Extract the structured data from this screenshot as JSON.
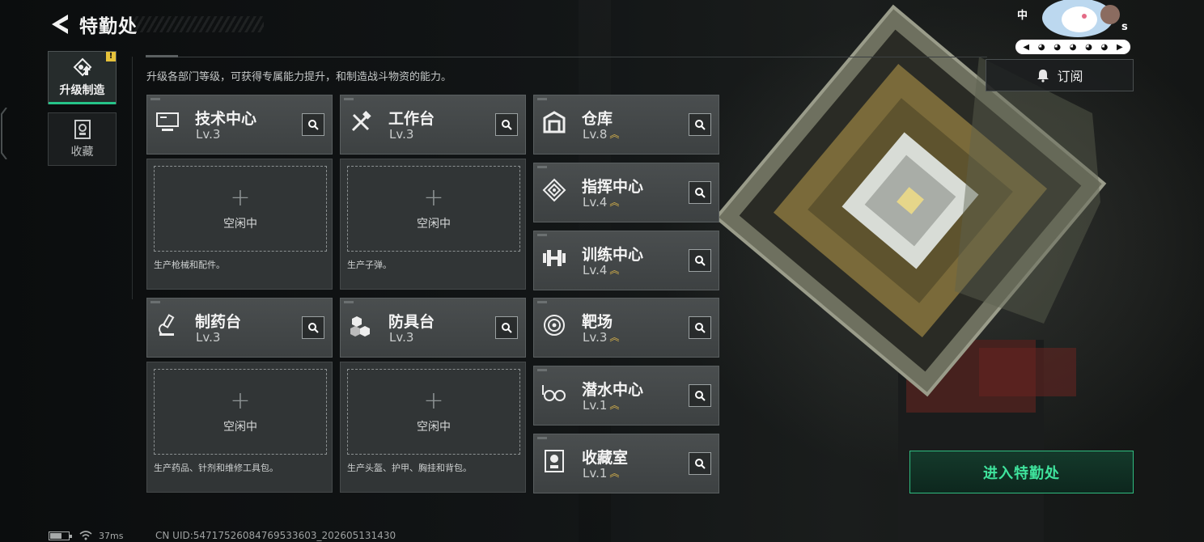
{
  "header": {
    "title": "特勤处"
  },
  "side_tabs": [
    {
      "label": "升级制造",
      "icon": "upgrade-manufacture-icon",
      "badge": "!",
      "active": true
    },
    {
      "label": "收藏",
      "icon": "collection-icon",
      "active": false
    }
  ],
  "description": "升级各部门等级，可获得专属能力提升，和制造战斗物资的能力。",
  "subscribe": {
    "label": "订阅",
    "icon": "bell-icon"
  },
  "production_facilities": [
    {
      "name": "技术中心",
      "level": "Lv.3",
      "icon": "computer-icon",
      "slot_status": "空闲中",
      "slot_desc": "生产枪械和配件。"
    },
    {
      "name": "工作台",
      "level": "Lv.3",
      "icon": "tools-icon",
      "slot_status": "空闲中",
      "slot_desc": "生产子弹。"
    },
    {
      "name": "制药台",
      "level": "Lv.3",
      "icon": "microscope-icon",
      "slot_status": "空闲中",
      "slot_desc": "生产药品、针剂和维修工具包。"
    },
    {
      "name": "防具台",
      "level": "Lv.3",
      "icon": "armor-blocks-icon",
      "slot_status": "空闲中",
      "slot_desc": "生产头盔、护甲、胸挂和背包。"
    }
  ],
  "other_facilities": [
    {
      "name": "仓库",
      "level": "Lv.8",
      "icon": "warehouse-icon"
    },
    {
      "name": "指挥中心",
      "level": "Lv.4",
      "icon": "command-icon"
    },
    {
      "name": "训练中心",
      "level": "Lv.4",
      "icon": "dumbbell-icon"
    },
    {
      "name": "靶场",
      "level": "Lv.3",
      "icon": "target-icon"
    },
    {
      "name": "潜水中心",
      "level": "Lv.1",
      "icon": "goggles-icon"
    },
    {
      "name": "收藏室",
      "level": "Lv.1",
      "icon": "collection-room-icon"
    }
  ],
  "enter_button": {
    "label": "进入特勤处"
  },
  "status": {
    "ping": "37ms",
    "uid": "CN UID:54717526084769533603_202605131430"
  },
  "overlay": {
    "tag_cn": "中",
    "tag_s": "s"
  },
  "colors": {
    "accent": "#26c489",
    "enter_text": "#3fe39d",
    "level_chevron": "#d9b44a"
  }
}
